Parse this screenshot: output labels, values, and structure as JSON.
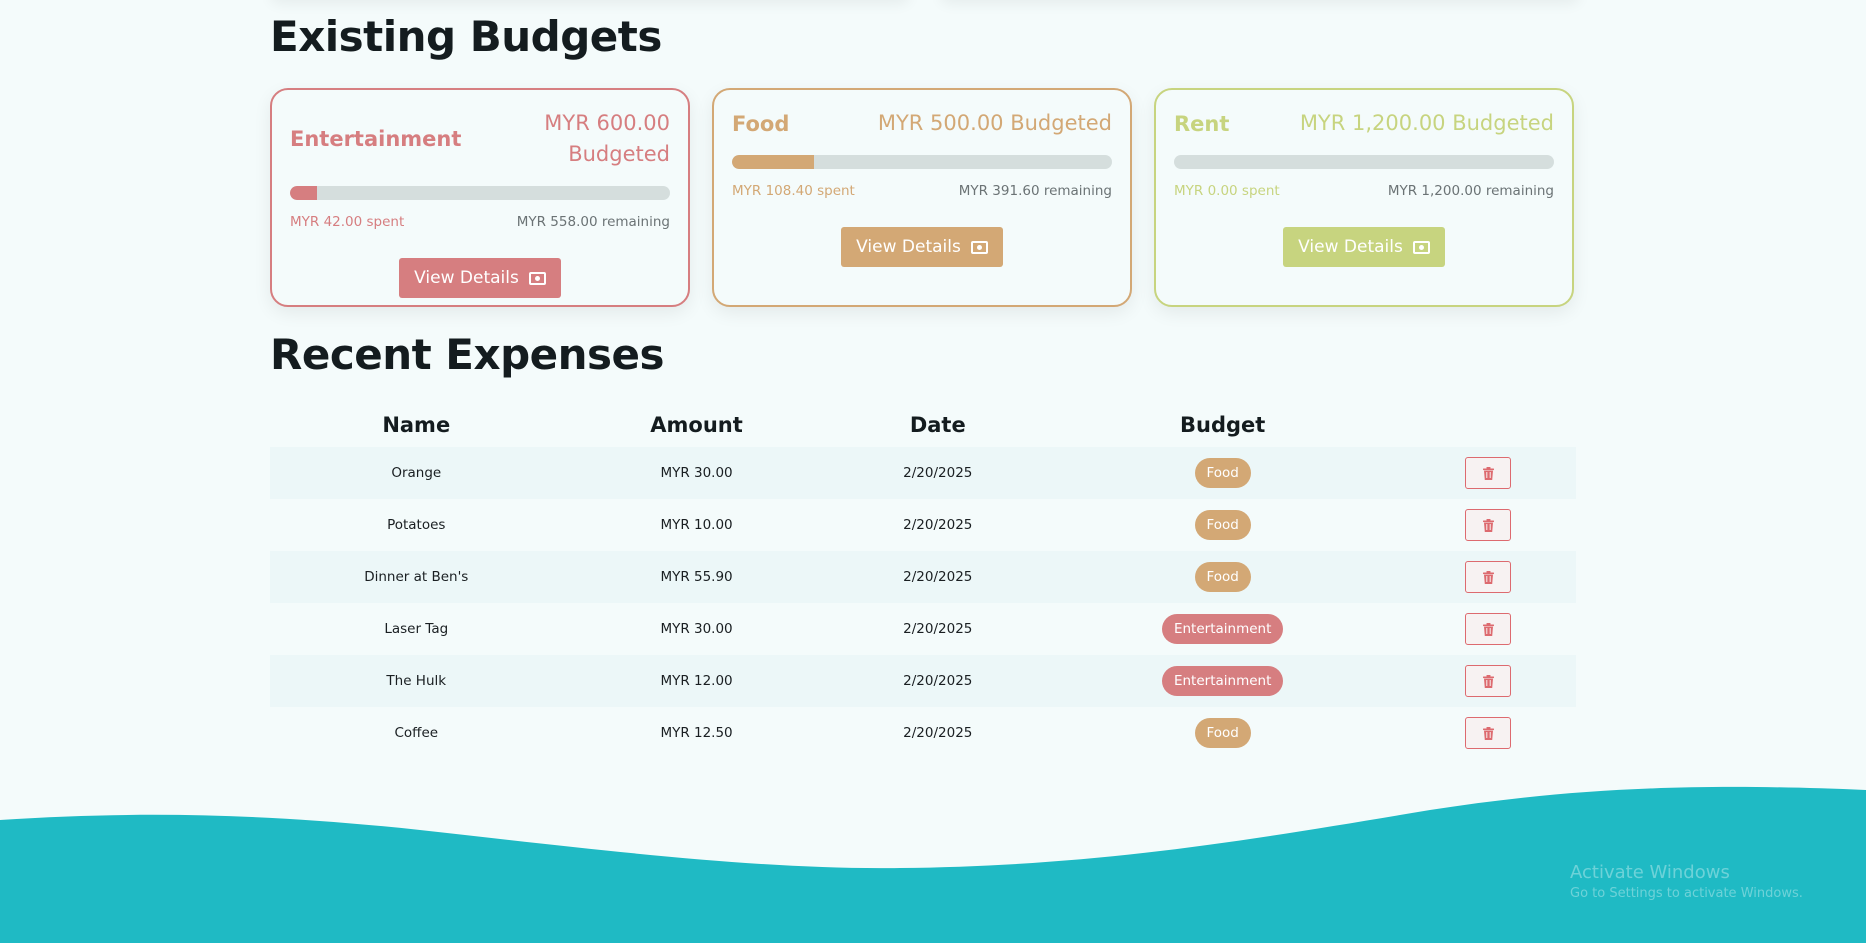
{
  "budgets_section": {
    "title": "Existing Budgets"
  },
  "budgets": [
    {
      "name": "Entertainment",
      "amount": "MYR 600.00 Budgeted",
      "amount_line1": "MYR 600.00",
      "amount_line2": "Budgeted",
      "spent": "MYR 42.00 spent",
      "remaining": "MYR 558.00 remaining",
      "progress": 0.07,
      "color": "#d67e80",
      "button": "View Details",
      "button_icon": "cash-icon"
    },
    {
      "name": "Food",
      "amount": "MYR 500.00 Budgeted",
      "spent": "MYR 108.40 spent",
      "remaining": "MYR 391.60 remaining",
      "progress": 0.2168,
      "color": "#d3a875",
      "button": "View Details",
      "button_icon": "cash-icon"
    },
    {
      "name": "Rent",
      "amount": "MYR 1,200.00 Budgeted",
      "spent": "MYR 0.00 spent",
      "remaining": "MYR 1,200.00 remaining",
      "progress": 0,
      "color": "#c7d47f",
      "button": "View Details",
      "button_icon": "cash-icon"
    }
  ],
  "expenses_section": {
    "title": "Recent Expenses",
    "columns": [
      "Name",
      "Amount",
      "Date",
      "Budget"
    ],
    "rows": [
      {
        "name": "Orange",
        "amount": "MYR 30.00",
        "date": "2/20/2025",
        "budget": "Food",
        "budget_color": "#d3a875"
      },
      {
        "name": "Potatoes",
        "amount": "MYR 10.00",
        "date": "2/20/2025",
        "budget": "Food",
        "budget_color": "#d3a875"
      },
      {
        "name": "Dinner at Ben's",
        "amount": "MYR 55.90",
        "date": "2/20/2025",
        "budget": "Food",
        "budget_color": "#d3a875"
      },
      {
        "name": "Laser Tag",
        "amount": "MYR 30.00",
        "date": "2/20/2025",
        "budget": "Entertainment",
        "budget_color": "#d67e80"
      },
      {
        "name": "The Hulk",
        "amount": "MYR 12.00",
        "date": "2/20/2025",
        "budget": "Entertainment",
        "budget_color": "#d67e80"
      },
      {
        "name": "Coffee",
        "amount": "MYR 12.50",
        "date": "2/20/2025",
        "budget": "Food",
        "budget_color": "#d3a875"
      }
    ],
    "delete_icon": "trash-icon",
    "delete_color": "#dd6a6f"
  },
  "footer": {
    "wave_color": "#1fbac4"
  },
  "watermark": {
    "title": "Activate Windows",
    "subtitle": "Go to Settings to activate Windows."
  }
}
